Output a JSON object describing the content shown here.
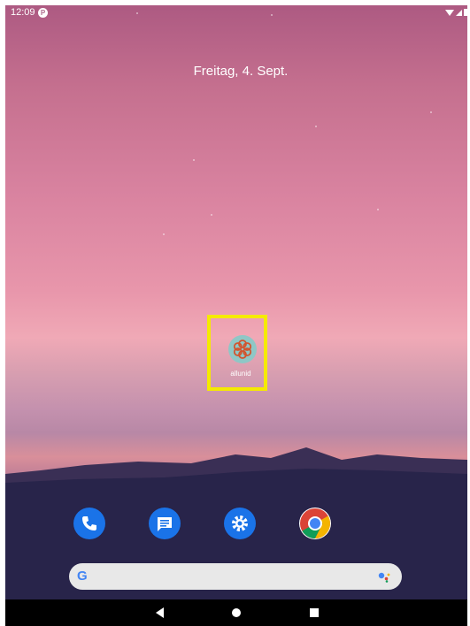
{
  "status_bar": {
    "time": "12:09",
    "notification_letter": "P"
  },
  "lockscreen": {
    "date": "Freitag, 4. Sept."
  },
  "home": {
    "app": {
      "label": "allunid",
      "icon": "flower-app-icon"
    },
    "dock": [
      {
        "name": "phone",
        "icon": "phone-icon",
        "color": "#1a73e8"
      },
      {
        "name": "messages",
        "icon": "messages-icon",
        "color": "#1a73e8"
      },
      {
        "name": "settings",
        "icon": "gear-icon",
        "color": "#1a73e8"
      },
      {
        "name": "chrome",
        "icon": "chrome-icon",
        "color": "#4285f4"
      }
    ],
    "search": {
      "logo": "G",
      "icon": "assistant-icon"
    }
  },
  "nav": {
    "back": "back-icon",
    "home": "home-icon",
    "recents": "recents-icon"
  },
  "colors": {
    "highlight": "#f5ea00",
    "accent": "#1a73e8"
  }
}
